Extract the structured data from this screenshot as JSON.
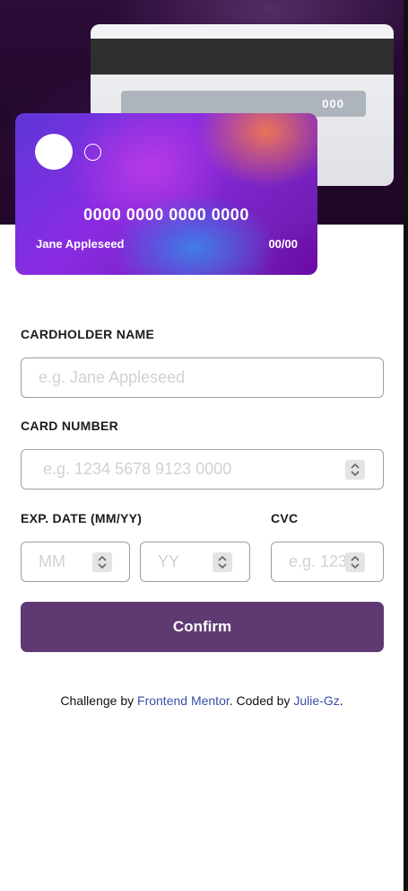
{
  "card_back": {
    "cvc": "000"
  },
  "card_front": {
    "number": "0000 0000 0000 0000",
    "name": "Jane Appleseed",
    "expiry": "00/00"
  },
  "form": {
    "name_label": "CARDHOLDER NAME",
    "name_placeholder": "e.g. Jane Appleseed",
    "number_label": "CARD NUMBER",
    "number_placeholder": "e.g. 1234 5678 9123 0000",
    "exp_label": "EXP. DATE (MM/YY)",
    "mm_placeholder": "MM",
    "yy_placeholder": "YY",
    "cvc_label": "CVC",
    "cvc_placeholder": "e.g. 123",
    "confirm_label": "Confirm"
  },
  "footer": {
    "prefix": "Challenge by ",
    "link1": "Frontend Mentor",
    "middle": ". Coded by ",
    "link2": "Julie-Gz",
    "suffix": "."
  },
  "colors": {
    "hero_bg": "#2a0c37",
    "button": "#5f3a72",
    "link": "#3a4fa8",
    "placeholder": "#cfd1d4"
  },
  "icons": {
    "spinner": "spinner-arrows-icon"
  }
}
